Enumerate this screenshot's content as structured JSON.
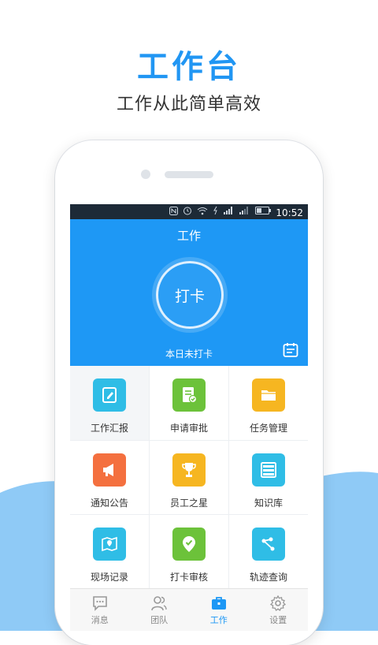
{
  "promo": {
    "title": "工作台",
    "subtitle": "工作从此简单高效"
  },
  "statusbar": {
    "icons": [
      "nfc-icon",
      "alarm-icon",
      "wifi-icon",
      "data-icon",
      "signal-icon",
      "signal-icon",
      "battery-icon"
    ],
    "time": "10:52"
  },
  "header": {
    "title": "工作",
    "punch_button": "打卡",
    "punch_status": "本日未打卡"
  },
  "grid": {
    "items": [
      {
        "label": "工作汇报",
        "icon": "report-edit-icon",
        "color": "#2fbde6"
      },
      {
        "label": "申请审批",
        "icon": "approval-doc-icon",
        "color": "#6cc23a"
      },
      {
        "label": "任务管理",
        "icon": "folder-icon",
        "color": "#f6b621"
      },
      {
        "label": "通知公告",
        "icon": "megaphone-icon",
        "color": "#f4703f"
      },
      {
        "label": "员工之星",
        "icon": "trophy-icon",
        "color": "#f6b621"
      },
      {
        "label": "知识库",
        "icon": "bookshelf-icon",
        "color": "#2fbde6"
      },
      {
        "label": "现场记录",
        "icon": "map-pin-icon",
        "color": "#2fbde6"
      },
      {
        "label": "打卡审核",
        "icon": "check-pin-icon",
        "color": "#6cc23a"
      },
      {
        "label": "轨迹查询",
        "icon": "route-icon",
        "color": "#2fbde6"
      }
    ]
  },
  "tabbar": {
    "items": [
      {
        "label": "消息",
        "icon": "chat-icon"
      },
      {
        "label": "团队",
        "icon": "team-icon"
      },
      {
        "label": "工作",
        "icon": "briefcase-icon"
      },
      {
        "label": "设置",
        "icon": "gear-icon"
      }
    ],
    "active": "工作"
  },
  "colors": {
    "brand_blue": "#1e98f5",
    "title_blue": "#2196f3",
    "wave_blue": "#8fcaf6"
  }
}
